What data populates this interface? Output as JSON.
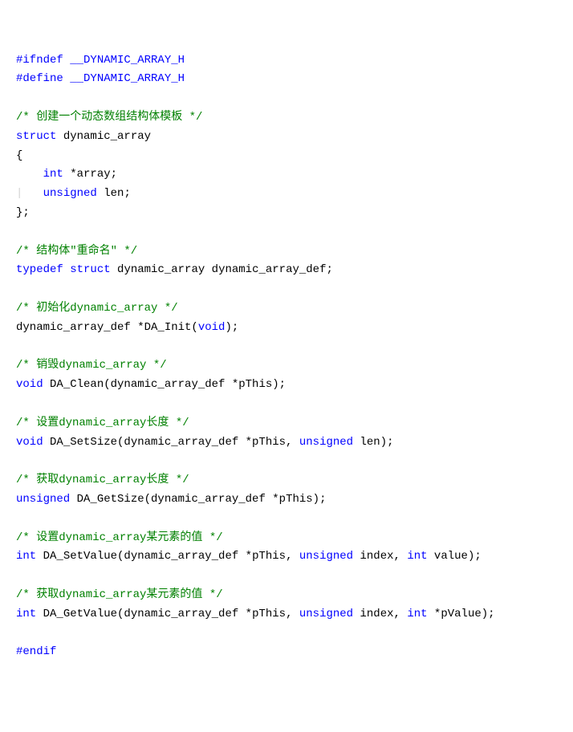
{
  "lines": {
    "l1_directive": "#ifndef",
    "l1_macro": "__DYNAMIC_ARRAY_H",
    "l2_directive": "#define",
    "l2_macro": "__DYNAMIC_ARRAY_H",
    "l4_comment": "/* 创建一个动态数组结构体模板 */",
    "l5_keyword": "struct",
    "l5_name": " dynamic_array",
    "l6_brace": "{",
    "l7_indent": "    ",
    "l7_type": "int",
    "l7_rest": " *array;",
    "l8_guide": "|",
    "l8_indent": "   ",
    "l8_type": "unsigned",
    "l8_rest": " len;",
    "l9_brace": "};",
    "l11_comment": "/* 结构体\"重命名\" */",
    "l12_kw1": "typedef",
    "l12_sp1": " ",
    "l12_kw2": "struct",
    "l12_rest": " dynamic_array dynamic_array_def;",
    "l14_comment": "/* 初始化dynamic_array */",
    "l15_pre": "dynamic_array_def *DA_Init(",
    "l15_kw": "void",
    "l15_post": ");",
    "l17_comment": "/* 销毁dynamic_array */",
    "l18_kw": "void",
    "l18_rest": " DA_Clean(dynamic_array_def *pThis);",
    "l20_comment": "/* 设置dynamic_array长度 */",
    "l21_kw1": "void",
    "l21_mid": " DA_SetSize(dynamic_array_def *pThis, ",
    "l21_kw2": "unsigned",
    "l21_post": " len);",
    "l23_comment": "/* 获取dynamic_array长度 */",
    "l24_kw": "unsigned",
    "l24_rest": " DA_GetSize(dynamic_array_def *pThis);",
    "l26_comment": "/* 设置dynamic_array某元素的值 */",
    "l27_kw1": "int",
    "l27_mid1": " DA_SetValue(dynamic_array_def *pThis, ",
    "l27_kw2": "unsigned",
    "l27_mid2": " index, ",
    "l27_kw3": "int",
    "l27_post": " value);",
    "l29_comment": "/* 获取dynamic_array某元素的值 */",
    "l30_kw1": "int",
    "l30_mid1": " DA_GetValue(dynamic_array_def *pThis, ",
    "l30_kw2": "unsigned",
    "l30_mid2": " index, ",
    "l30_kw3": "int",
    "l30_post": " *pValue);",
    "l32_directive": "#endif"
  }
}
